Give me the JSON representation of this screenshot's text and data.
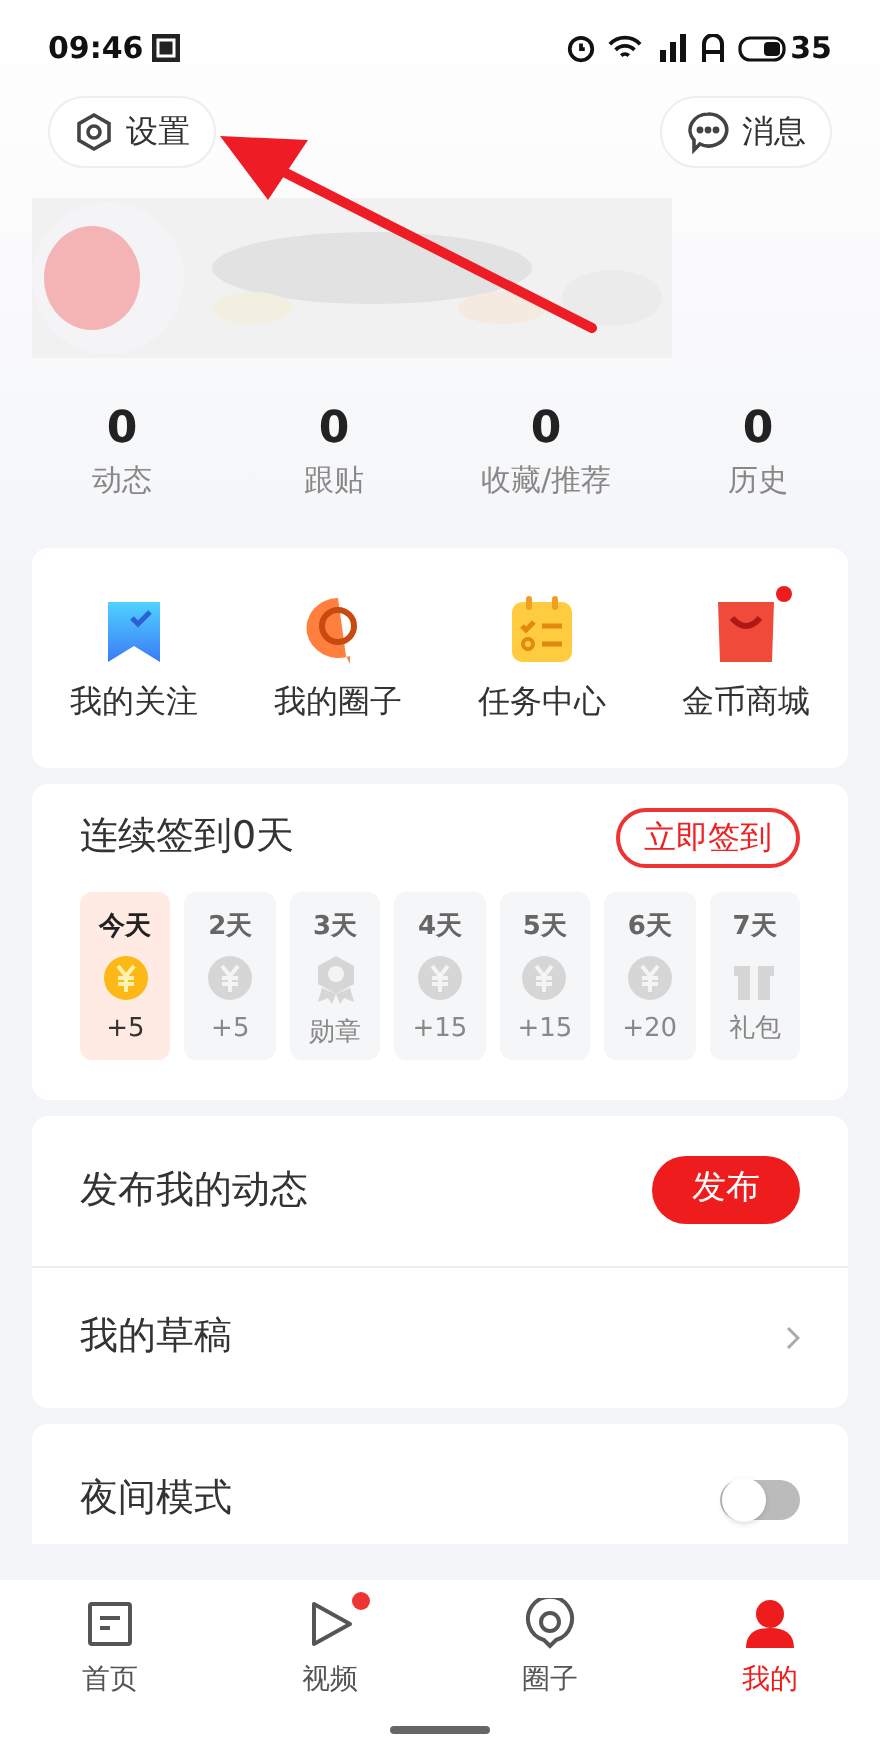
{
  "status_bar": {
    "time": "09:46",
    "battery": "35"
  },
  "header": {
    "settings": "设置",
    "messages": "消息"
  },
  "stats": [
    {
      "value": "0",
      "label": "动态"
    },
    {
      "value": "0",
      "label": "跟贴"
    },
    {
      "value": "0",
      "label": "收藏/推荐"
    },
    {
      "value": "0",
      "label": "历史"
    }
  ],
  "shortcuts": [
    {
      "kind": "bookmark",
      "label": "我的关注",
      "badge": false
    },
    {
      "kind": "bubble",
      "label": "我的圈子",
      "badge": false
    },
    {
      "kind": "calendar",
      "label": "任务中心",
      "badge": false
    },
    {
      "kind": "bag",
      "label": "金币商城",
      "badge": true
    }
  ],
  "checkin": {
    "title": "连续签到0天",
    "button": "立即签到",
    "days": [
      {
        "kind": "coin",
        "day": "今天",
        "reward": "+5",
        "selected": true
      },
      {
        "kind": "coin",
        "day": "2天",
        "reward": "+5",
        "selected": false
      },
      {
        "kind": "medal",
        "day": "3天",
        "reward": "勋章",
        "selected": false
      },
      {
        "kind": "coin",
        "day": "4天",
        "reward": "+15",
        "selected": false
      },
      {
        "kind": "coin",
        "day": "5天",
        "reward": "+15",
        "selected": false
      },
      {
        "kind": "coin",
        "day": "6天",
        "reward": "+20",
        "selected": false
      },
      {
        "kind": "gift",
        "day": "7天",
        "reward": "礼包",
        "selected": false
      }
    ]
  },
  "post": {
    "title": "发布我的动态",
    "button": "发布"
  },
  "drafts": {
    "title": "我的草稿"
  },
  "night_mode": {
    "title": "夜间模式",
    "on": false
  },
  "tabs": [
    {
      "kind": "home",
      "label": "首页",
      "selected": false,
      "badge": false
    },
    {
      "kind": "video",
      "label": "视频",
      "selected": false,
      "badge": true
    },
    {
      "kind": "circle",
      "label": "圈子",
      "selected": false,
      "badge": false
    },
    {
      "kind": "me",
      "label": "我的",
      "selected": true,
      "badge": false
    }
  ]
}
